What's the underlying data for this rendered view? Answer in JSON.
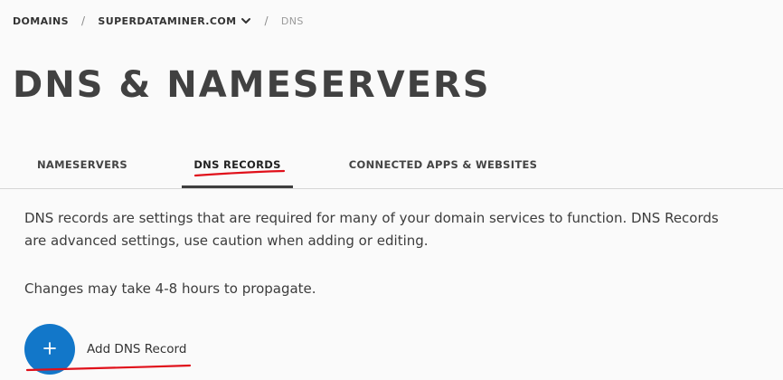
{
  "breadcrumb": {
    "root": "DOMAINS",
    "separator": "/",
    "domain": "SUPERDATAMINER.COM",
    "current": "DNS"
  },
  "page": {
    "title": "DNS & NAMESERVERS"
  },
  "tabs": [
    {
      "label": "NAMESERVERS",
      "active": false
    },
    {
      "label": "DNS RECORDS",
      "active": true
    },
    {
      "label": "CONNECTED APPS & WEBSITES",
      "active": false
    }
  ],
  "content": {
    "description": "DNS records are settings that are required for many of your domain services to function. DNS Records are advanced settings, use caution when adding or editing.",
    "propagation_note": "Changes may take 4-8 hours to propagate.",
    "add_record_label": "Add DNS Record"
  },
  "colors": {
    "accent": "#1277c9",
    "annotation": "#e0101a",
    "text": "#3a3a3a",
    "background": "#fafafa"
  },
  "icons": {
    "domain_dropdown": "chevron-down-icon",
    "add_button": "plus-icon"
  }
}
